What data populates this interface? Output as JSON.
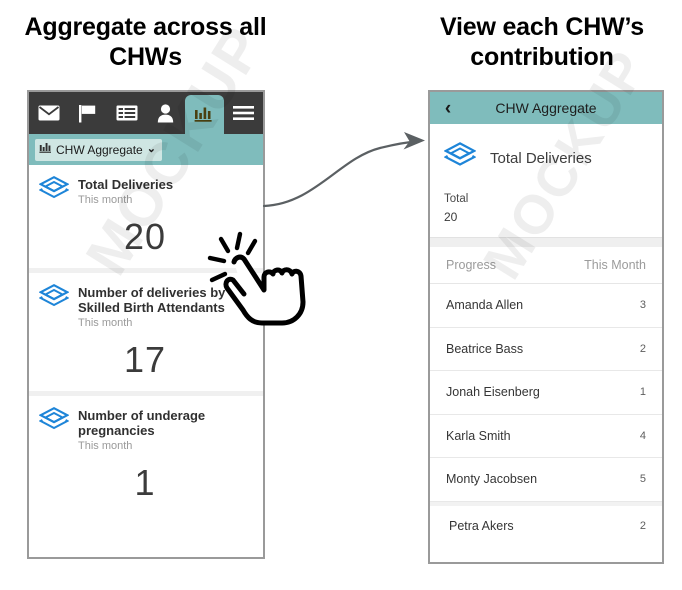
{
  "headings": {
    "left": "Aggregate across all CHWs",
    "right": "View each CHW’s contribution"
  },
  "watermark": "MOCKUP",
  "colors": {
    "teal": "#7fbcbc",
    "teal_light": "#cfe6e3",
    "navbar_dark": "#3b3b3b",
    "icon_blue": "#1e85d8",
    "value_gray": "#3b3b3b",
    "muted_gray": "#9a9a9a"
  },
  "left_phone": {
    "nav_items": [
      {
        "name": "messages",
        "icon": "envelope-icon",
        "active": false
      },
      {
        "name": "tasks",
        "icon": "flag-icon",
        "active": false
      },
      {
        "name": "reports",
        "icon": "list-icon",
        "active": false
      },
      {
        "name": "people",
        "icon": "person-icon",
        "active": false
      },
      {
        "name": "analytics",
        "icon": "bar-chart-icon",
        "active": true
      },
      {
        "name": "menu",
        "icon": "hamburger-icon",
        "active": false
      }
    ],
    "dropdown": {
      "icon": "bar-chart-icon",
      "label": "CHW Aggregate",
      "chevron": "⌄"
    },
    "cards": [
      {
        "icon": "layers-icon",
        "title": "Total Deliveries",
        "subtitle": "This month",
        "value": "20"
      },
      {
        "icon": "layers-icon",
        "title": "Number of deliveries by Skilled Birth Attendants",
        "subtitle": "This month",
        "value": "17"
      },
      {
        "icon": "layers-icon",
        "title": "Number of underage pregnancies",
        "subtitle": "This month",
        "value": "1"
      }
    ]
  },
  "right_phone": {
    "appbar": {
      "back": "‹",
      "title": "CHW Aggregate"
    },
    "detail": {
      "icon": "layers-icon",
      "title": "Total Deliveries",
      "total_label": "Total",
      "total_value": "20"
    },
    "list_header": {
      "left": "Progress",
      "right": "This Month"
    },
    "rows": [
      {
        "name": "Amanda Allen",
        "value": "3"
      },
      {
        "name": "Beatrice Bass",
        "value": "2"
      },
      {
        "name": "Jonah Eisenberg",
        "value": "1"
      },
      {
        "name": "Karla Smith",
        "value": "4"
      },
      {
        "name": "Monty Jacobsen",
        "value": "5"
      },
      {
        "name": "Petra Akers",
        "value": "2"
      }
    ]
  }
}
